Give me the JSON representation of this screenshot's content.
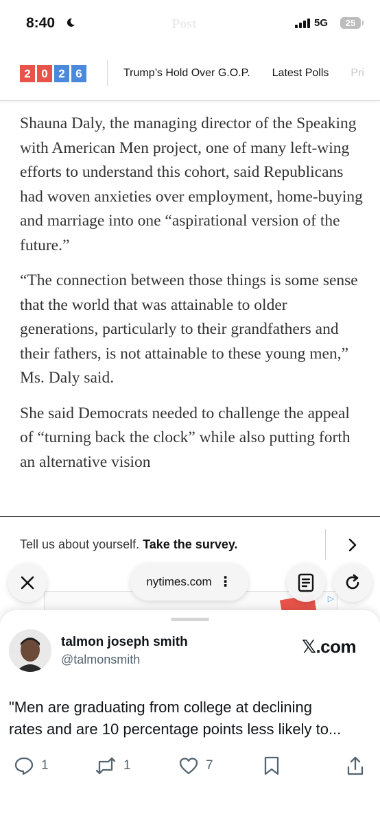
{
  "status_bar": {
    "time": "8:40",
    "ghost_title": "Post",
    "network": "5G",
    "battery": "25"
  },
  "nav": {
    "logo_digits": [
      "2",
      "0",
      "2",
      "6"
    ],
    "logo_colors": [
      "#e8544a",
      "#e8544a",
      "#4a89dc",
      "#4a89dc"
    ],
    "links": [
      "Trump’s Hold Over G.O.P.",
      "Latest Polls",
      "Pri"
    ]
  },
  "article": {
    "paragraphs": [
      "Shauna Daly, the managing director of the Speaking with American Men project, one of many left-wing efforts to understand this cohort, said Republicans had woven anxieties over employment, home-buying and marriage into one “aspirational version of the future.”",
      "“The connection between those things is some sense that the world that was attainable to older generations, particularly to their grandfathers and their fathers, is not attainable to these young men,” Ms. Daly said.",
      "She said Democrats needed to challenge the appeal of “turning back the clock” while also putting forth an alternative vision"
    ]
  },
  "survey": {
    "prefix": "Tell us about yourself.",
    "cta": "Take the survey."
  },
  "browser": {
    "url": "nytimes.com"
  },
  "tweet": {
    "author_name": "talmon joseph smith",
    "author_handle": "@talmonsmith",
    "source": "𝕏.com",
    "text_lines": [
      "\"Men are graduating from college at declining",
      "rates and are 10 percentage points less likely to..."
    ],
    "replies": "1",
    "reposts": "1",
    "likes": "7"
  }
}
